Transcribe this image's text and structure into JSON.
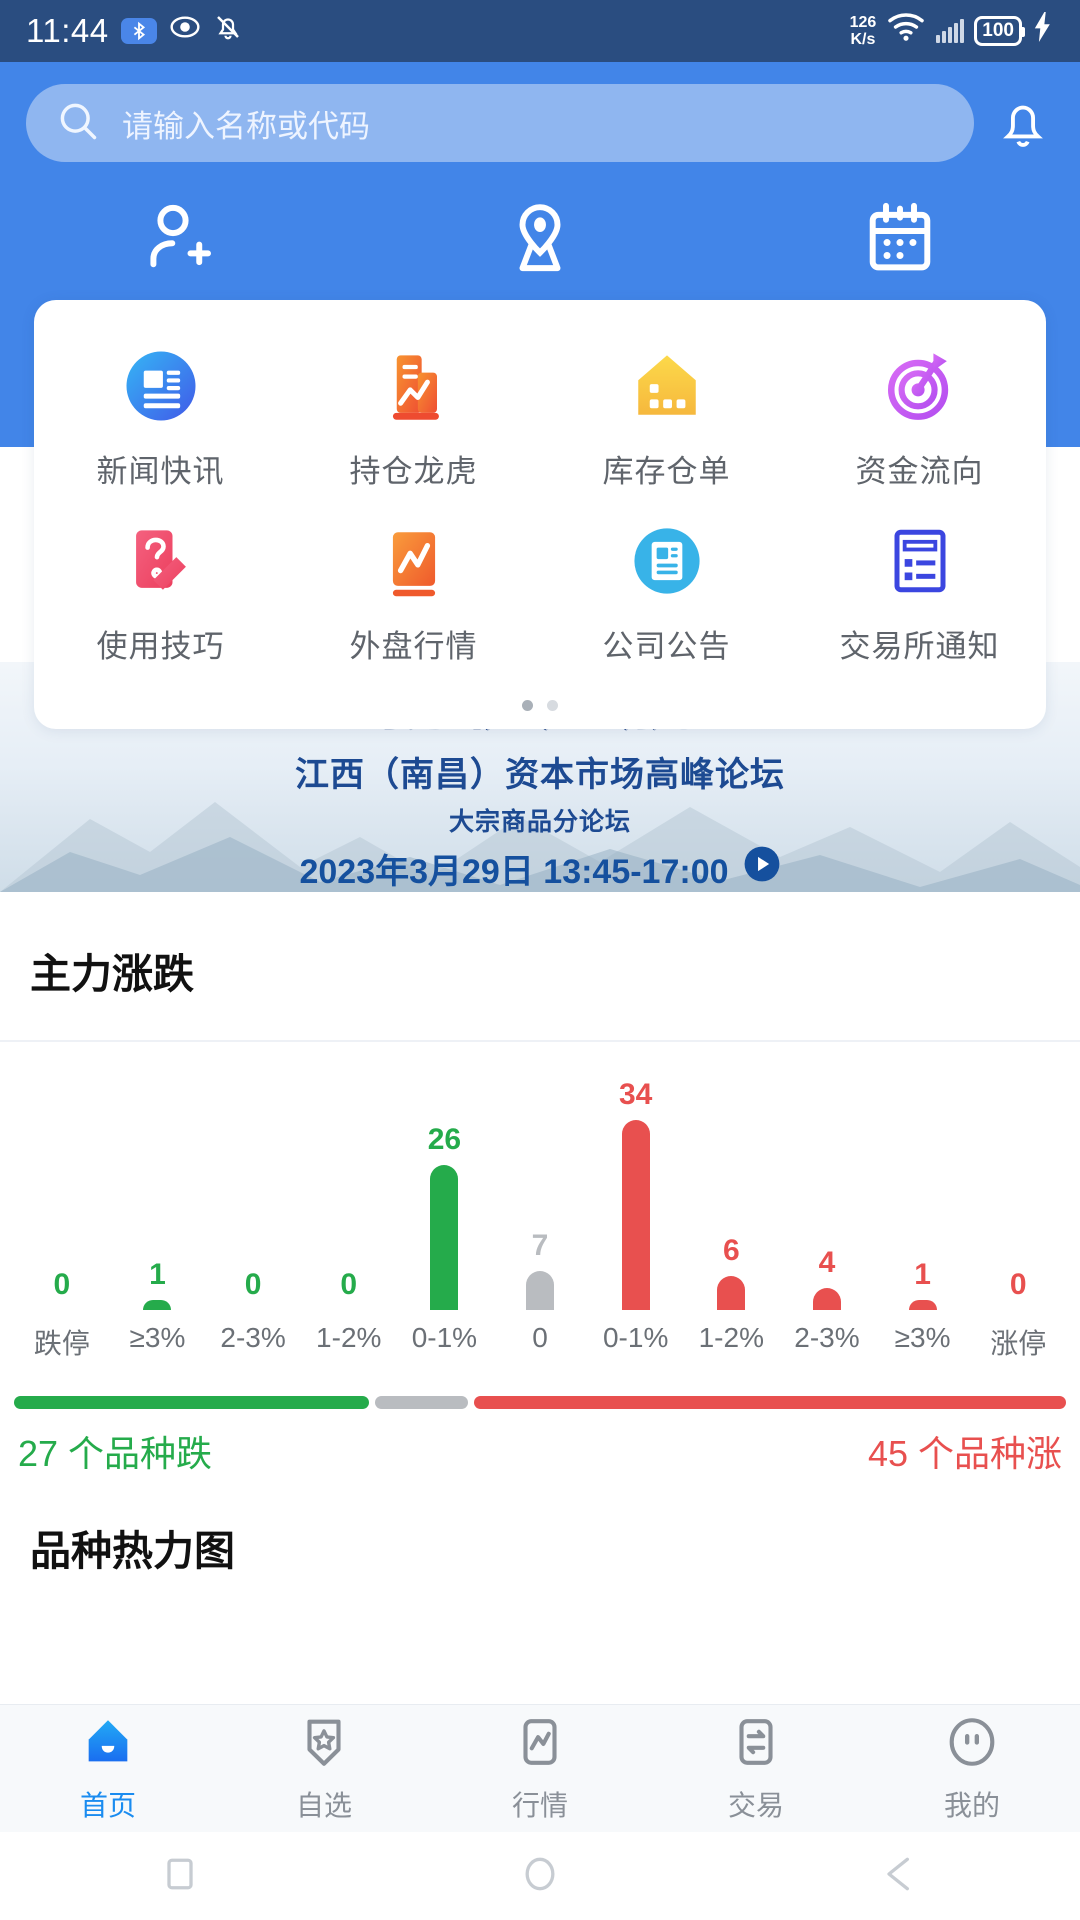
{
  "statusbar": {
    "time": "11:44",
    "net_speed_value": "126",
    "net_speed_unit": "K/s",
    "battery": "100",
    "icons": [
      "bluetooth-icon",
      "eye-icon",
      "bell-muted-icon",
      "wifi-icon",
      "signal-icon",
      "battery-icon",
      "charging-icon"
    ]
  },
  "search": {
    "placeholder": "请输入名称或代码",
    "icon": "search-icon",
    "bell_icon": "bell-icon"
  },
  "quick_actions": [
    {
      "label": "期货开户",
      "icon": "user-plus-icon"
    },
    {
      "label": "掌上营业厅",
      "icon": "location-pin-icon"
    },
    {
      "label": "财经日历",
      "icon": "calendar-icon"
    }
  ],
  "grid": {
    "items": [
      {
        "label": "新闻快讯",
        "icon": "news-circle-icon",
        "color": "#3d8bf2"
      },
      {
        "label": "持仓龙虎",
        "icon": "chart-document-icon",
        "color": "#f4702a"
      },
      {
        "label": "库存仓单",
        "icon": "warehouse-icon",
        "color": "#fbcb36"
      },
      {
        "label": "资金流向",
        "icon": "target-arrow-icon",
        "color": "#cf5bf0"
      },
      {
        "label": "使用技巧",
        "icon": "question-pencil-icon",
        "color": "#ef5472"
      },
      {
        "label": "外盘行情",
        "icon": "trend-card-icon",
        "color": "#f4853a"
      },
      {
        "label": "公司公告",
        "icon": "announcement-icon",
        "color": "#36b0e8"
      },
      {
        "label": "交易所通知",
        "icon": "notice-list-icon",
        "color": "#3b46e0"
      }
    ],
    "page_dots": 2,
    "active_dot": 0
  },
  "banner": {
    "title": "扬帆起航",
    "subtitle": "江西（南昌）资本市场高峰论坛",
    "subtitle2": "大宗商品分论坛",
    "date_time": "2023年3月29日  13:45-17:00",
    "play_icon": "play-circle-icon"
  },
  "main_section": {
    "title": "主力涨跌",
    "next_section_title": "品种热力图"
  },
  "chart_data": {
    "type": "bar",
    "title": "主力涨跌",
    "categories": [
      "跌停",
      "≥3%",
      "2-3%",
      "1-2%",
      "0-1%",
      "0",
      "0-1%",
      "1-2%",
      "2-3%",
      "≥3%",
      "涨停"
    ],
    "values": [
      0,
      1,
      0,
      0,
      26,
      7,
      34,
      6,
      4,
      1,
      0
    ],
    "bar_colors": [
      "#25ab4b",
      "#25ab4b",
      "#25ab4b",
      "#25ab4b",
      "#25ab4b",
      "#b9bcc0",
      "#e8504f",
      "#e8504f",
      "#e8504f",
      "#e8504f",
      "#e8504f"
    ],
    "xlabel": "",
    "ylabel": "",
    "ylim": [
      0,
      34
    ],
    "grid": false,
    "legend": "none",
    "annotations": {
      "down_label": "27 个品种跌",
      "up_label": "45 个品种涨",
      "down_count": 27,
      "up_count": 45,
      "flat_count": 7
    },
    "colors": {
      "down": "#25ab4b",
      "flat": "#b9bcc0",
      "up": "#e8504f"
    }
  },
  "tabbar": {
    "items": [
      {
        "label": "首页",
        "icon": "home-icon",
        "active": true
      },
      {
        "label": "自选",
        "icon": "star-badge-icon",
        "active": false
      },
      {
        "label": "行情",
        "icon": "quote-chart-icon",
        "active": false
      },
      {
        "label": "交易",
        "icon": "trade-swap-icon",
        "active": false
      },
      {
        "label": "我的",
        "icon": "profile-icon",
        "active": false
      }
    ],
    "active_color": "#1a8cf0"
  },
  "android_nav": {
    "items": [
      "square-recents-icon",
      "circle-home-icon",
      "triangle-back-icon"
    ]
  }
}
